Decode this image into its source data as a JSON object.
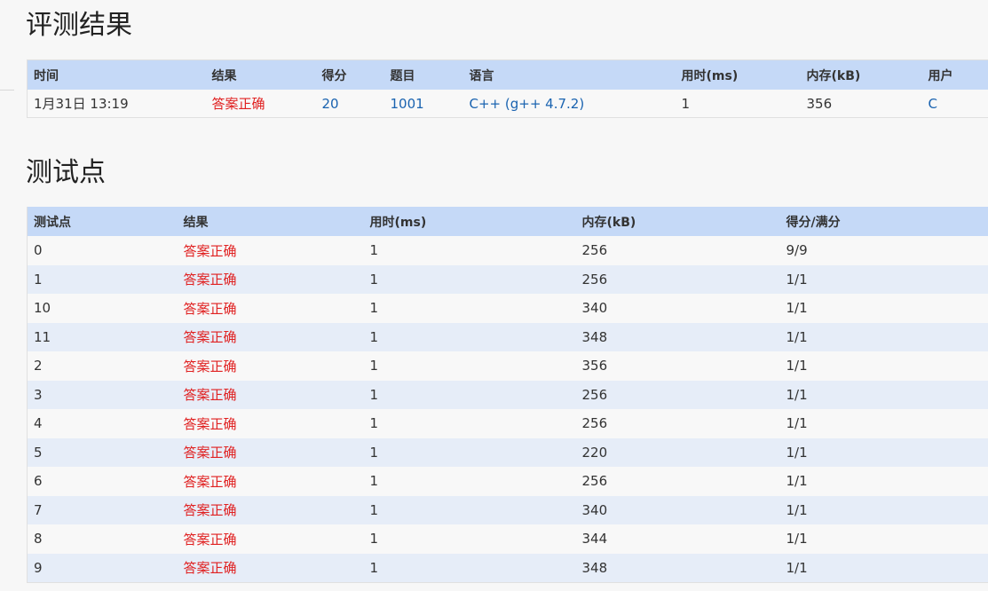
{
  "result_section": {
    "title": "评测结果",
    "headers": {
      "time": "时间",
      "result": "结果",
      "score": "得分",
      "problem": "题目",
      "language": "语言",
      "duration": "用时(ms)",
      "memory": "内存(kB)",
      "user": "用户"
    },
    "row": {
      "time": "1月31日 13:19",
      "result": "答案正确",
      "score": "20",
      "problem": "1001",
      "language": "C++ (g++ 4.7.2)",
      "duration": "1",
      "memory": "356",
      "user": "C"
    }
  },
  "cases_section": {
    "title": "测试点",
    "headers": {
      "case": "测试点",
      "result": "结果",
      "duration": "用时(ms)",
      "memory": "内存(kB)",
      "score": "得分/满分"
    },
    "rows": [
      {
        "case": "0",
        "result": "答案正确",
        "duration": "1",
        "memory": "256",
        "score": "9/9"
      },
      {
        "case": "1",
        "result": "答案正确",
        "duration": "1",
        "memory": "256",
        "score": "1/1"
      },
      {
        "case": "10",
        "result": "答案正确",
        "duration": "1",
        "memory": "340",
        "score": "1/1"
      },
      {
        "case": "11",
        "result": "答案正确",
        "duration": "1",
        "memory": "348",
        "score": "1/1"
      },
      {
        "case": "2",
        "result": "答案正确",
        "duration": "1",
        "memory": "356",
        "score": "1/1"
      },
      {
        "case": "3",
        "result": "答案正确",
        "duration": "1",
        "memory": "256",
        "score": "1/1"
      },
      {
        "case": "4",
        "result": "答案正确",
        "duration": "1",
        "memory": "256",
        "score": "1/1"
      },
      {
        "case": "5",
        "result": "答案正确",
        "duration": "1",
        "memory": "220",
        "score": "1/1"
      },
      {
        "case": "6",
        "result": "答案正确",
        "duration": "1",
        "memory": "256",
        "score": "1/1"
      },
      {
        "case": "7",
        "result": "答案正确",
        "duration": "1",
        "memory": "340",
        "score": "1/1"
      },
      {
        "case": "8",
        "result": "答案正确",
        "duration": "1",
        "memory": "344",
        "score": "1/1"
      },
      {
        "case": "9",
        "result": "答案正确",
        "duration": "1",
        "memory": "348",
        "score": "1/1"
      }
    ]
  },
  "colors": {
    "header_background": "#c5d9f7",
    "row_alt_background": "#e6edf8",
    "accepted": "#e02020",
    "link": "#1a63b0"
  }
}
